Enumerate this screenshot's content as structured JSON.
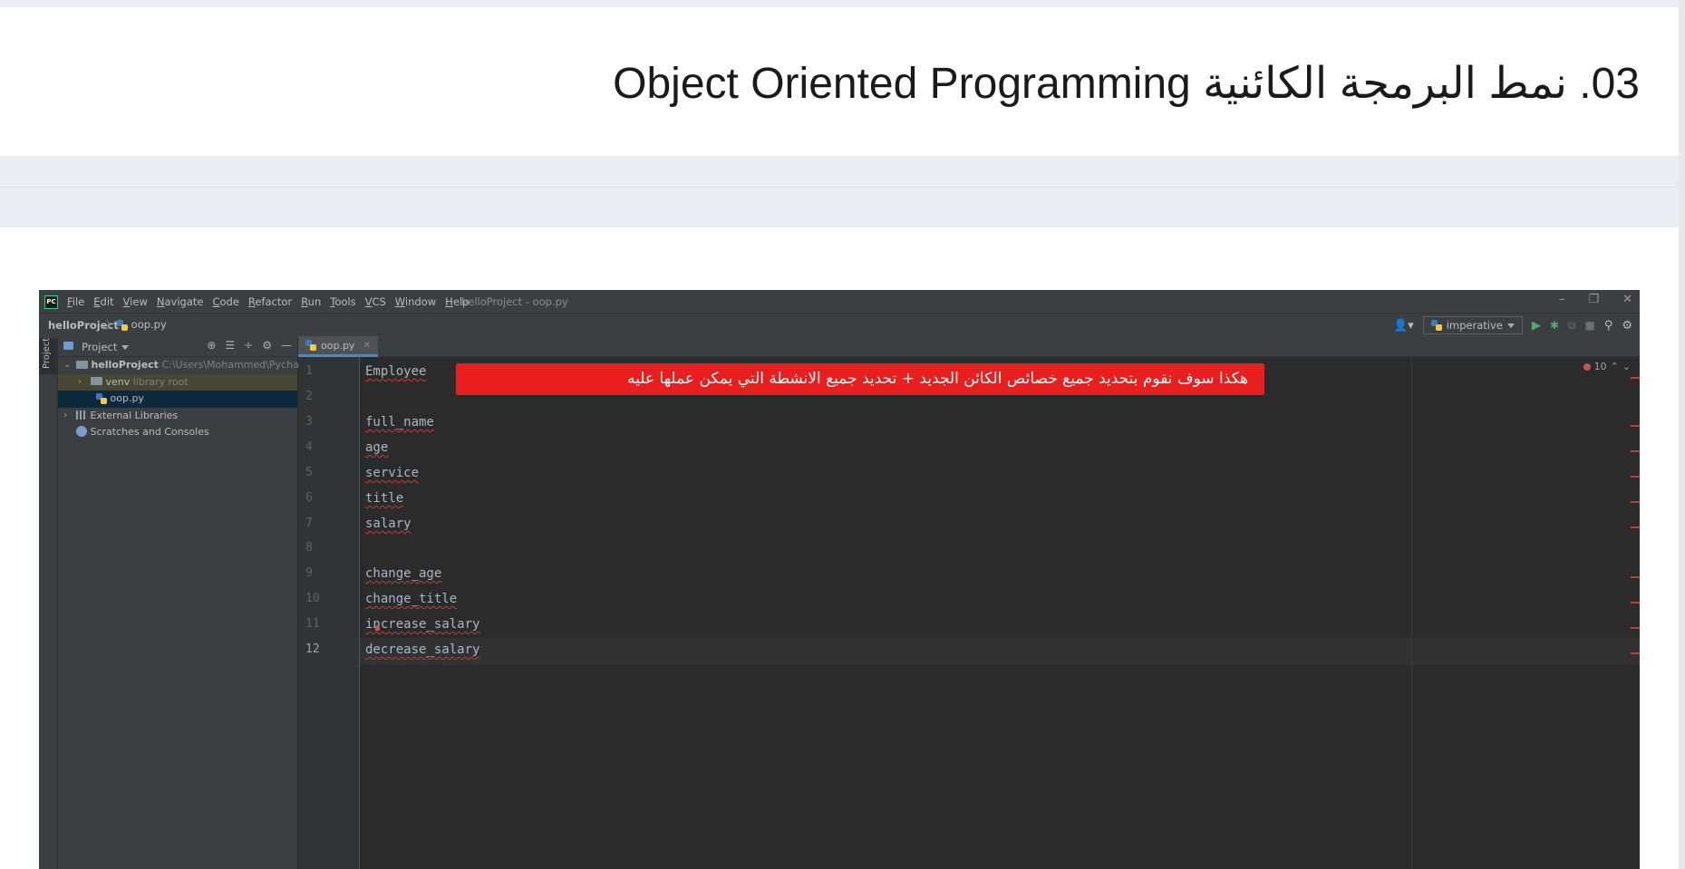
{
  "page": {
    "title": "03. نمط البرمجة الكائنية Object Oriented Programming"
  },
  "ide": {
    "logo_text": "PC",
    "menu": [
      "File",
      "Edit",
      "View",
      "Navigate",
      "Code",
      "Refactor",
      "Run",
      "Tools",
      "VCS",
      "Window",
      "Help"
    ],
    "window_title": "helloProject - oop.py",
    "breadcrumb": {
      "project": "helloProject",
      "file": "oop.py"
    },
    "run_config": "imperative",
    "project_panel": {
      "title": "Project",
      "stripe_label": "Project",
      "tree": [
        {
          "label": "helloProject",
          "detail": "C:\\Users\\Mohammed\\PycharmPr"
        },
        {
          "label": "venv",
          "detail": "library root"
        },
        {
          "label": "oop.py",
          "detail": ""
        },
        {
          "label": "External Libraries",
          "detail": ""
        },
        {
          "label": "Scratches and Consoles",
          "detail": ""
        }
      ]
    },
    "editor_tab": "oop.py",
    "error_count": "10",
    "lines": [
      {
        "n": "1",
        "code": "Employee"
      },
      {
        "n": "2",
        "code": ""
      },
      {
        "n": "3",
        "code": "full_name"
      },
      {
        "n": "4",
        "code": "age"
      },
      {
        "n": "5",
        "code": "service"
      },
      {
        "n": "6",
        "code": "title"
      },
      {
        "n": "7",
        "code": "salary"
      },
      {
        "n": "8",
        "code": ""
      },
      {
        "n": "9",
        "code": "change_age"
      },
      {
        "n": "10",
        "code": "change_title"
      },
      {
        "n": "11",
        "code": "increase_salary"
      },
      {
        "n": "12",
        "code": "decrease_salary"
      }
    ],
    "annotation": "هكذا سوف نقوم بتحديد جميع خصائص الكائن الجديد + تحديد جميع الانشطة التي يمكن عملها عليه"
  },
  "colors": {
    "accent_tab": "#4a88c7",
    "annotation_bg": "#e91e1e",
    "error_underline": "#bc3f3c",
    "code_text": "#a9b7c6"
  },
  "icons": [
    "pycharm-logo-icon",
    "python-file-icon",
    "folder-icon",
    "library-icon",
    "scratch-icon",
    "run-icon",
    "debug-icon",
    "search-icon",
    "gear-icon",
    "error-icon"
  ]
}
